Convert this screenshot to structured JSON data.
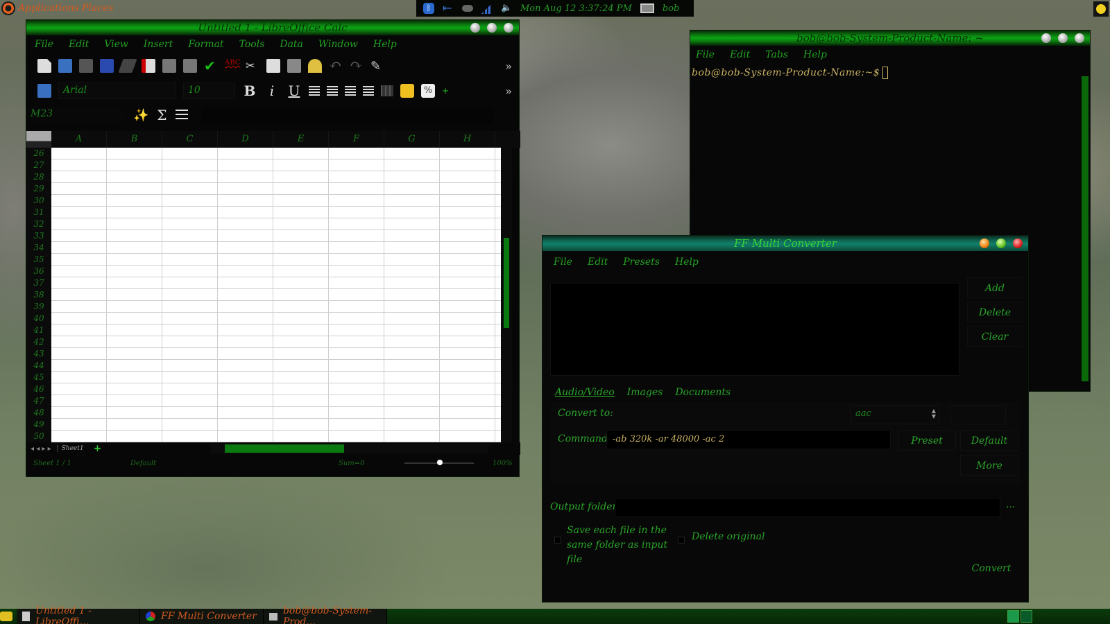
{
  "top_panel": {
    "apps_label": "Applications",
    "places_label": "Places",
    "clock": "Mon Aug 12    3:37:24 PM",
    "user": "bob"
  },
  "calc": {
    "title": "Untitled 1 - LibreOffice Calc",
    "menu": [
      "File",
      "Edit",
      "View",
      "Insert",
      "Format",
      "Tools",
      "Data",
      "Window",
      "Help"
    ],
    "font_name": "Arial",
    "font_size": "10",
    "cell_ref": "M23",
    "columns": [
      "A",
      "B",
      "C",
      "D",
      "E",
      "F",
      "G",
      "H"
    ],
    "rows": [
      "26",
      "27",
      "28",
      "29",
      "30",
      "31",
      "32",
      "33",
      "34",
      "35",
      "36",
      "37",
      "38",
      "39",
      "40",
      "41",
      "42",
      "43",
      "44",
      "45",
      "46",
      "47",
      "48",
      "49",
      "50"
    ],
    "sheet_tab": "Sheet1",
    "status": {
      "sheet": "Sheet 1 / 1",
      "style": "Default",
      "sum": "Sum=0",
      "zoom": "100%"
    }
  },
  "terminal": {
    "title": "bob@bob-System-Product-Name: ~",
    "menu": [
      "File",
      "Edit",
      "Tabs",
      "Help"
    ],
    "prompt": "bob@bob-System-Product-Name:~$"
  },
  "ffmc": {
    "title": "FF Multi Converter",
    "menu": [
      "File",
      "Edit",
      "Presets",
      "Help"
    ],
    "side_buttons": [
      "Add",
      "Delete",
      "Clear"
    ],
    "tabs": [
      "Audio/Video",
      "Images",
      "Documents"
    ],
    "convert_to_label": "Convert to:",
    "convert_to_value": "aac",
    "command_label": "Command:",
    "command_value": "-ab 320k -ar 48000 -ac 2",
    "preset_btn": "Preset",
    "default_btn": "Default",
    "more_btn": "More",
    "output_label": "Output folder:",
    "browse_btn": "...",
    "same_folder_label": "Save each file in the same folder as input file",
    "delete_original_label": "Delete original",
    "convert_btn": "Convert"
  },
  "taskbar": {
    "items": [
      "Untitled 1 - LibreOffi...",
      "FF Multi Converter",
      "bob@bob-System-Prod..."
    ]
  }
}
